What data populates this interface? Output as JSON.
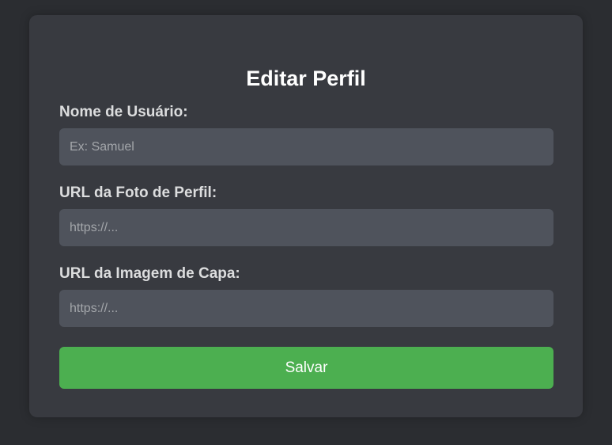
{
  "form": {
    "title": "Editar Perfil",
    "fields": [
      {
        "label": "Nome de Usuário:",
        "value": "",
        "placeholder": "Ex: Samuel"
      },
      {
        "label": "URL da Foto de Perfil:",
        "value": "",
        "placeholder": "https://..."
      },
      {
        "label": "URL da Imagem de Capa:",
        "value": "",
        "placeholder": "https://..."
      }
    ],
    "save_label": "Salvar"
  },
  "colors": {
    "page_background": "#2b2d31",
    "card_background": "#383a40",
    "input_background": "#4f535c",
    "accent": "#4caf50",
    "text": "#ffffff"
  }
}
